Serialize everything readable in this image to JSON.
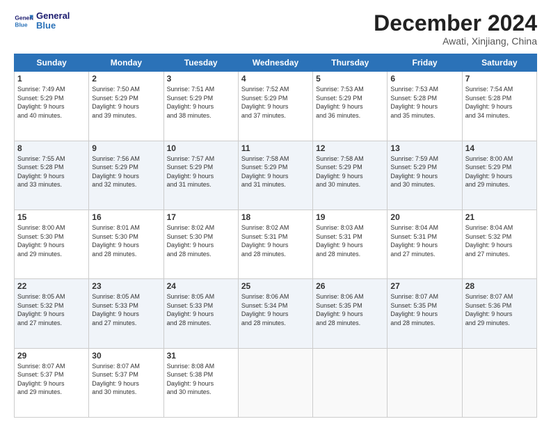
{
  "logo": {
    "line1": "General",
    "line2": "Blue"
  },
  "title": "December 2024",
  "subtitle": "Awati, Xinjiang, China",
  "weekdays": [
    "Sunday",
    "Monday",
    "Tuesday",
    "Wednesday",
    "Thursday",
    "Friday",
    "Saturday"
  ],
  "weeks": [
    [
      {
        "day": "1",
        "info": "Sunrise: 7:49 AM\nSunset: 5:29 PM\nDaylight: 9 hours\nand 40 minutes."
      },
      {
        "day": "2",
        "info": "Sunrise: 7:50 AM\nSunset: 5:29 PM\nDaylight: 9 hours\nand 39 minutes."
      },
      {
        "day": "3",
        "info": "Sunrise: 7:51 AM\nSunset: 5:29 PM\nDaylight: 9 hours\nand 38 minutes."
      },
      {
        "day": "4",
        "info": "Sunrise: 7:52 AM\nSunset: 5:29 PM\nDaylight: 9 hours\nand 37 minutes."
      },
      {
        "day": "5",
        "info": "Sunrise: 7:53 AM\nSunset: 5:29 PM\nDaylight: 9 hours\nand 36 minutes."
      },
      {
        "day": "6",
        "info": "Sunrise: 7:53 AM\nSunset: 5:28 PM\nDaylight: 9 hours\nand 35 minutes."
      },
      {
        "day": "7",
        "info": "Sunrise: 7:54 AM\nSunset: 5:28 PM\nDaylight: 9 hours\nand 34 minutes."
      }
    ],
    [
      {
        "day": "8",
        "info": "Sunrise: 7:55 AM\nSunset: 5:28 PM\nDaylight: 9 hours\nand 33 minutes."
      },
      {
        "day": "9",
        "info": "Sunrise: 7:56 AM\nSunset: 5:29 PM\nDaylight: 9 hours\nand 32 minutes."
      },
      {
        "day": "10",
        "info": "Sunrise: 7:57 AM\nSunset: 5:29 PM\nDaylight: 9 hours\nand 31 minutes."
      },
      {
        "day": "11",
        "info": "Sunrise: 7:58 AM\nSunset: 5:29 PM\nDaylight: 9 hours\nand 31 minutes."
      },
      {
        "day": "12",
        "info": "Sunrise: 7:58 AM\nSunset: 5:29 PM\nDaylight: 9 hours\nand 30 minutes."
      },
      {
        "day": "13",
        "info": "Sunrise: 7:59 AM\nSunset: 5:29 PM\nDaylight: 9 hours\nand 30 minutes."
      },
      {
        "day": "14",
        "info": "Sunrise: 8:00 AM\nSunset: 5:29 PM\nDaylight: 9 hours\nand 29 minutes."
      }
    ],
    [
      {
        "day": "15",
        "info": "Sunrise: 8:00 AM\nSunset: 5:30 PM\nDaylight: 9 hours\nand 29 minutes."
      },
      {
        "day": "16",
        "info": "Sunrise: 8:01 AM\nSunset: 5:30 PM\nDaylight: 9 hours\nand 28 minutes."
      },
      {
        "day": "17",
        "info": "Sunrise: 8:02 AM\nSunset: 5:30 PM\nDaylight: 9 hours\nand 28 minutes."
      },
      {
        "day": "18",
        "info": "Sunrise: 8:02 AM\nSunset: 5:31 PM\nDaylight: 9 hours\nand 28 minutes."
      },
      {
        "day": "19",
        "info": "Sunrise: 8:03 AM\nSunset: 5:31 PM\nDaylight: 9 hours\nand 28 minutes."
      },
      {
        "day": "20",
        "info": "Sunrise: 8:04 AM\nSunset: 5:31 PM\nDaylight: 9 hours\nand 27 minutes."
      },
      {
        "day": "21",
        "info": "Sunrise: 8:04 AM\nSunset: 5:32 PM\nDaylight: 9 hours\nand 27 minutes."
      }
    ],
    [
      {
        "day": "22",
        "info": "Sunrise: 8:05 AM\nSunset: 5:32 PM\nDaylight: 9 hours\nand 27 minutes."
      },
      {
        "day": "23",
        "info": "Sunrise: 8:05 AM\nSunset: 5:33 PM\nDaylight: 9 hours\nand 27 minutes."
      },
      {
        "day": "24",
        "info": "Sunrise: 8:05 AM\nSunset: 5:33 PM\nDaylight: 9 hours\nand 28 minutes."
      },
      {
        "day": "25",
        "info": "Sunrise: 8:06 AM\nSunset: 5:34 PM\nDaylight: 9 hours\nand 28 minutes."
      },
      {
        "day": "26",
        "info": "Sunrise: 8:06 AM\nSunset: 5:35 PM\nDaylight: 9 hours\nand 28 minutes."
      },
      {
        "day": "27",
        "info": "Sunrise: 8:07 AM\nSunset: 5:35 PM\nDaylight: 9 hours\nand 28 minutes."
      },
      {
        "day": "28",
        "info": "Sunrise: 8:07 AM\nSunset: 5:36 PM\nDaylight: 9 hours\nand 29 minutes."
      }
    ],
    [
      {
        "day": "29",
        "info": "Sunrise: 8:07 AM\nSunset: 5:37 PM\nDaylight: 9 hours\nand 29 minutes."
      },
      {
        "day": "30",
        "info": "Sunrise: 8:07 AM\nSunset: 5:37 PM\nDaylight: 9 hours\nand 30 minutes."
      },
      {
        "day": "31",
        "info": "Sunrise: 8:08 AM\nSunset: 5:38 PM\nDaylight: 9 hours\nand 30 minutes."
      },
      null,
      null,
      null,
      null
    ]
  ]
}
